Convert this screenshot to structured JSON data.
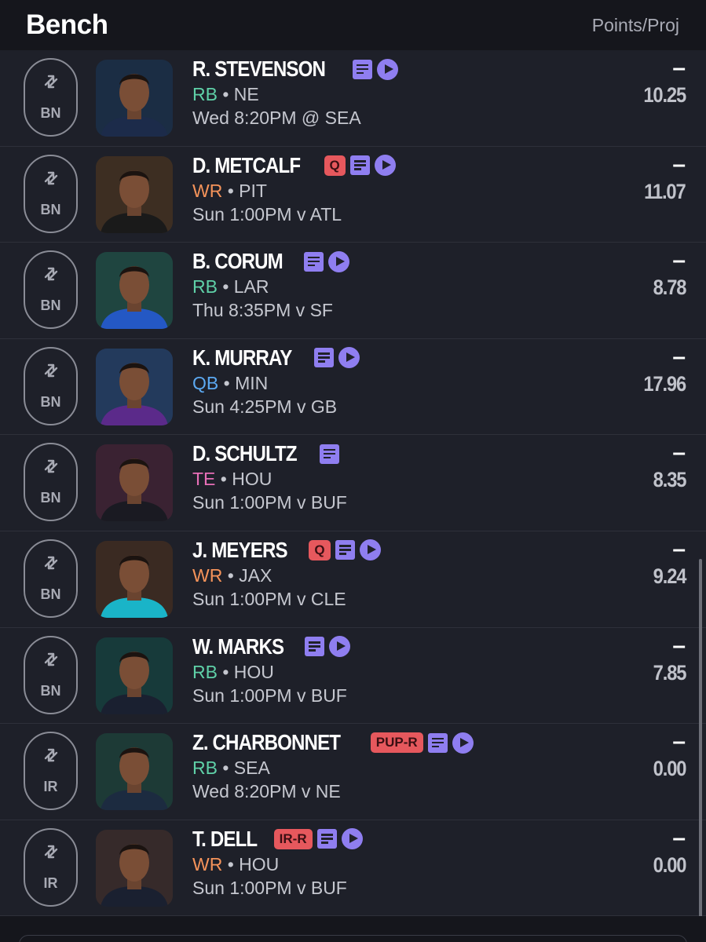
{
  "header": {
    "title": "Bench",
    "column_label": "Points/Proj"
  },
  "colors": {
    "RB": "#5fd1a8",
    "WR": "#f5935a",
    "QB": "#5ca9f2",
    "TE": "#e86fb8",
    "accent": "#8f7ef0",
    "status": "#e6585d"
  },
  "players": [
    {
      "slot": "BN",
      "name": "R. STEVENSON",
      "status": "",
      "notes": true,
      "video": true,
      "pos": "RB",
      "team": "NE",
      "game": "Wed 8:20PM @ SEA",
      "points": "–",
      "proj": "10.25",
      "avatar_bg": "#1b2d44",
      "jersey": "#1c2b4a"
    },
    {
      "slot": "BN",
      "name": "D. METCALF",
      "status": "Q",
      "notes": true,
      "video": true,
      "pos": "WR",
      "team": "PIT",
      "game": "Sun 1:00PM v ATL",
      "points": "–",
      "proj": "11.07",
      "avatar_bg": "#3d2e22",
      "jersey": "#1a1a1a"
    },
    {
      "slot": "BN",
      "name": "B. CORUM",
      "status": "",
      "notes": true,
      "video": true,
      "pos": "RB",
      "team": "LAR",
      "game": "Thu 8:35PM v SF",
      "points": "–",
      "proj": "8.78",
      "avatar_bg": "#1f4540",
      "jersey": "#2458c4"
    },
    {
      "slot": "BN",
      "name": "K. MURRAY",
      "status": "",
      "notes": true,
      "video": true,
      "pos": "QB",
      "team": "MIN",
      "game": "Sun 4:25PM v GB",
      "points": "–",
      "proj": "17.96",
      "avatar_bg": "#233a5c",
      "jersey": "#5b2a8a"
    },
    {
      "slot": "BN",
      "name": "D. SCHULTZ",
      "status": "",
      "notes": true,
      "video": false,
      "pos": "TE",
      "team": "HOU",
      "game": "Sun 1:00PM v BUF",
      "points": "–",
      "proj": "8.35",
      "avatar_bg": "#3a2232",
      "jersey": "#1a1a22"
    },
    {
      "slot": "BN",
      "name": "J. MEYERS",
      "status": "Q",
      "notes": true,
      "video": true,
      "pos": "WR",
      "team": "JAX",
      "game": "Sun 1:00PM v CLE",
      "points": "–",
      "proj": "9.24",
      "avatar_bg": "#3a2a22",
      "jersey": "#1ab4c8"
    },
    {
      "slot": "BN",
      "name": "W. MARKS",
      "status": "",
      "notes": true,
      "video": true,
      "pos": "RB",
      "team": "HOU",
      "game": "Sun 1:00PM v BUF",
      "points": "–",
      "proj": "7.85",
      "avatar_bg": "#173a3a",
      "jersey": "#1a2030"
    },
    {
      "slot": "IR",
      "name": "Z. CHARBONNET",
      "status": "PUP-R",
      "notes": true,
      "video": true,
      "pos": "RB",
      "team": "SEA",
      "game": "Wed 8:20PM v NE",
      "points": "–",
      "proj": "0.00",
      "avatar_bg": "#1d3a36",
      "jersey": "#1c2b40"
    },
    {
      "slot": "IR",
      "name": "T. DELL",
      "status": "IR-R",
      "notes": true,
      "video": true,
      "pos": "WR",
      "team": "HOU",
      "game": "Sun 1:00PM v BUF",
      "points": "–",
      "proj": "0.00",
      "avatar_bg": "#362a2a",
      "jersey": "#1a2030"
    }
  ]
}
